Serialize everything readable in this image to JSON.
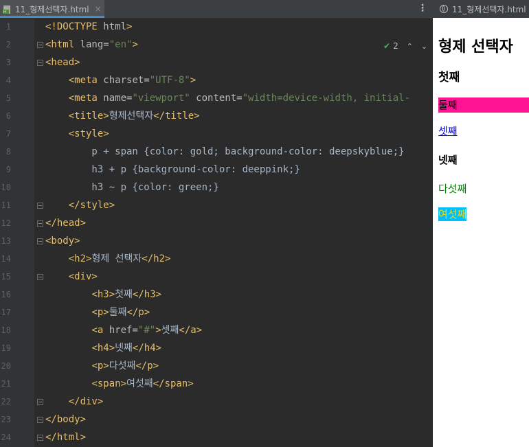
{
  "editor": {
    "tab_title": "11_형제선택자.html",
    "tab_close": "×",
    "more": "⋮",
    "inspections": {
      "count": "2",
      "up": "⌃",
      "down": "⌄"
    },
    "line_numbers": [
      "1",
      "2",
      "3",
      "4",
      "5",
      "6",
      "7",
      "8",
      "9",
      "10",
      "11",
      "12",
      "13",
      "14",
      "15",
      "16",
      "17",
      "18",
      "19",
      "20",
      "21",
      "22",
      "23",
      "24"
    ],
    "lines": [
      [
        [
          "tag",
          "<!DOCTYPE "
        ],
        [
          "attr",
          "html"
        ],
        [
          "tag",
          ">"
        ]
      ],
      [
        [
          "tag",
          "<html "
        ],
        [
          "attr",
          "lang="
        ],
        [
          "str",
          "\"en\""
        ],
        [
          "tag",
          ">"
        ]
      ],
      [
        [
          "tag",
          "<head>"
        ]
      ],
      [
        [
          "txt",
          "    "
        ],
        [
          "tag",
          "<meta "
        ],
        [
          "attr",
          "charset="
        ],
        [
          "str",
          "\"UTF-8\""
        ],
        [
          "tag",
          ">"
        ]
      ],
      [
        [
          "txt",
          "    "
        ],
        [
          "tag",
          "<meta "
        ],
        [
          "attr",
          "name="
        ],
        [
          "str",
          "\"viewport\""
        ],
        [
          "attr",
          " content="
        ],
        [
          "str",
          "\"width=device-width, initial-"
        ]
      ],
      [
        [
          "txt",
          "    "
        ],
        [
          "tag",
          "<title>"
        ],
        [
          "txt",
          "형제선택자"
        ],
        [
          "tag",
          "</title>"
        ]
      ],
      [
        [
          "txt",
          "    "
        ],
        [
          "tag",
          "<style>"
        ]
      ],
      [
        [
          "css",
          "        p + span {color: gold; background-color: deepskyblue;}"
        ]
      ],
      [
        [
          "css",
          "        h3 + p {background-color: deeppink;}"
        ]
      ],
      [
        [
          "css",
          "        h3 ~ p {color: green;}"
        ]
      ],
      [
        [
          "txt",
          "    "
        ],
        [
          "tag",
          "</style>"
        ]
      ],
      [
        [
          "tag",
          "</head>"
        ]
      ],
      [
        [
          "tag",
          "<body>"
        ]
      ],
      [
        [
          "txt",
          "    "
        ],
        [
          "tag",
          "<h2>"
        ],
        [
          "txt",
          "형제 선택자"
        ],
        [
          "tag",
          "</h2>"
        ]
      ],
      [
        [
          "txt",
          "    "
        ],
        [
          "tag",
          "<div>"
        ]
      ],
      [
        [
          "txt",
          "        "
        ],
        [
          "tag",
          "<h3>"
        ],
        [
          "txt",
          "첫째"
        ],
        [
          "tag",
          "</h3>"
        ]
      ],
      [
        [
          "txt",
          "        "
        ],
        [
          "tag",
          "<p>"
        ],
        [
          "txt",
          "둘째"
        ],
        [
          "tag",
          "</p>"
        ]
      ],
      [
        [
          "txt",
          "        "
        ],
        [
          "tag",
          "<a "
        ],
        [
          "attr",
          "href="
        ],
        [
          "str",
          "\"#\""
        ],
        [
          "tag",
          ">"
        ],
        [
          "txt",
          "셋째"
        ],
        [
          "tag",
          "</a>"
        ]
      ],
      [
        [
          "txt",
          "        "
        ],
        [
          "tag",
          "<h4>"
        ],
        [
          "txt",
          "넷째"
        ],
        [
          "tag",
          "</h4>"
        ]
      ],
      [
        [
          "txt",
          "        "
        ],
        [
          "tag",
          "<p>"
        ],
        [
          "txt",
          "다섯째"
        ],
        [
          "tag",
          "</p>"
        ]
      ],
      [
        [
          "txt",
          "        "
        ],
        [
          "tag",
          "<span>"
        ],
        [
          "txt",
          "여섯째"
        ],
        [
          "tag",
          "</span>"
        ]
      ],
      [
        [
          "txt",
          "    "
        ],
        [
          "tag",
          "</div>"
        ]
      ],
      [
        [
          "tag",
          "</body>"
        ]
      ],
      [
        [
          "tag",
          "</html>"
        ]
      ]
    ],
    "colors": {
      "tag": "#e8bf6a",
      "attr": "#bababa",
      "string": "#6a8759",
      "text": "#a9b7c6",
      "background": "#2b2b2b"
    }
  },
  "preview": {
    "tab_title": "11_형제선택자.html",
    "h2": "형제 선택자",
    "h3": "첫째",
    "p1": "둘째",
    "a": "셋째",
    "h4": "넷째",
    "p2": "다섯째",
    "span": "여섯째"
  }
}
